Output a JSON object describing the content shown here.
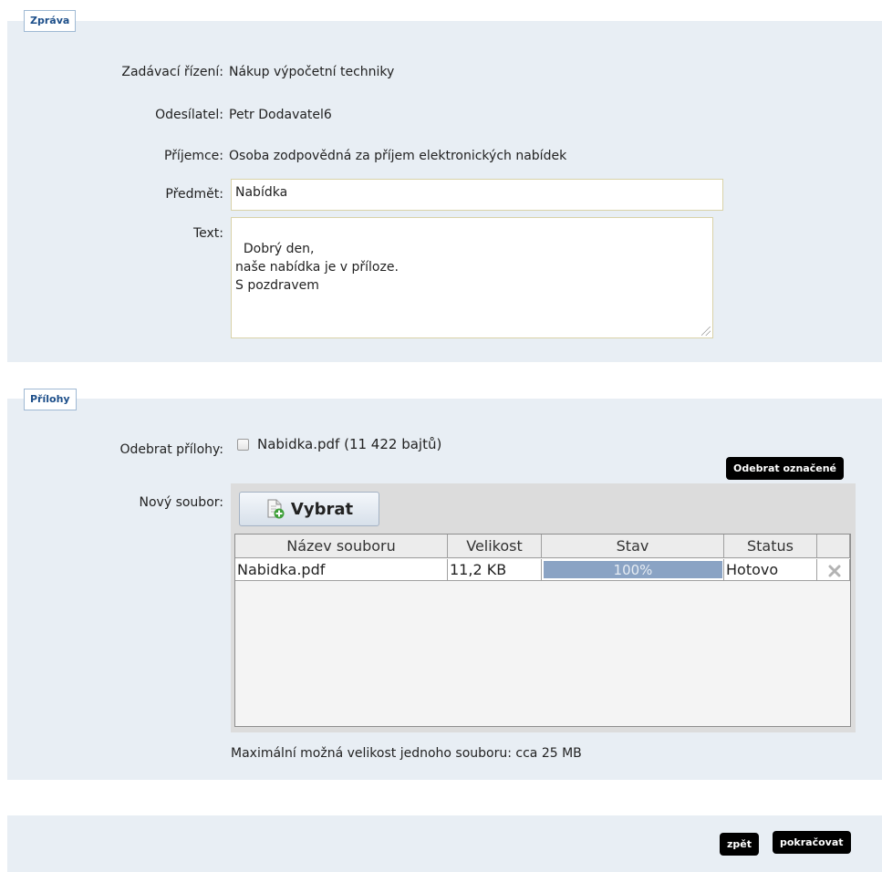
{
  "message_section": {
    "legend": "Zpráva",
    "procedure_label": "Zadávací řízení:",
    "procedure_value": "Nákup výpočetní techniky",
    "sender_label": "Odesílatel:",
    "sender_value": "Petr Dodavatel6",
    "recipient_label": "Příjemce:",
    "recipient_value": "Osoba zodpovědná za příjem elektronických nabídek",
    "subject_label": "Předmět:",
    "subject_value": "Nabídka",
    "text_label": "Text:",
    "text_value": "Dobrý den,\nnaše nabídka je v příloze.\nS pozdravem"
  },
  "attachments_section": {
    "legend": "Přílohy",
    "remove_label": "Odebrat přílohy:",
    "existing_file": "Nabidka.pdf (11 422 bajtů)",
    "existing_file_checked": false,
    "remove_selected_button": "Odebrat označené",
    "new_file_label": "Nový soubor:",
    "choose_button": "Vybrat",
    "choose_icon": "file-add-icon",
    "table": {
      "columns": [
        "Název souboru",
        "Velikost",
        "Stav",
        "Status",
        ""
      ],
      "rows": [
        {
          "name": "Nabidka.pdf",
          "size": "11,2 KB",
          "progress_text": "100%",
          "progress": 1.0,
          "status": "Hotovo",
          "remove_icon": "close-icon"
        }
      ]
    },
    "max_size_note": "Maximální možná velikost jednoho souboru: cca 25 MB"
  },
  "footer": {
    "back_button": "zpět",
    "continue_button": "pokračovat"
  },
  "colors": {
    "panel_bg": "#e8eef4",
    "legend_text": "#1d4f8a",
    "progress_fill": "#8aa3c4",
    "button_bg": "#000000"
  }
}
